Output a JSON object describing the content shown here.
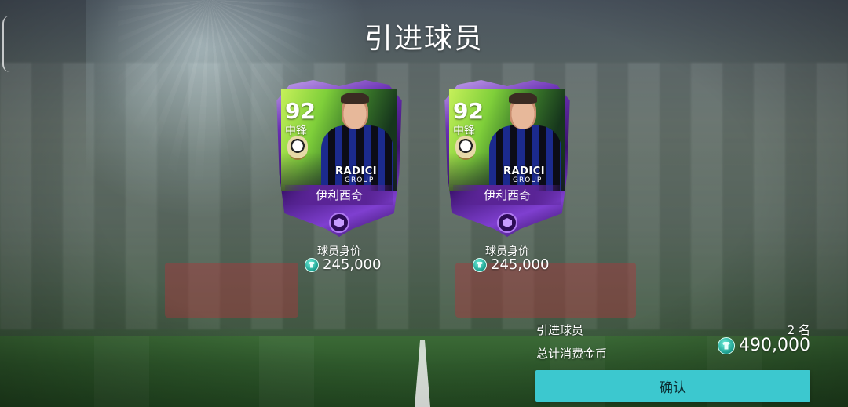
{
  "title": "引进球员",
  "players": [
    {
      "rating": "92",
      "position": "中锋",
      "name": "伊利西奇",
      "sponsor": "RADICI",
      "sponsor_sub": "GROUP",
      "value_label": "球员身价",
      "value": "245,000"
    },
    {
      "rating": "92",
      "position": "中锋",
      "name": "伊利西奇",
      "sponsor": "RADICI",
      "sponsor_sub": "GROUP",
      "value_label": "球员身价",
      "value": "245,000"
    }
  ],
  "summary": {
    "players_label": "引进球员",
    "players_count": "2 名",
    "total_label": "总计消费金币",
    "total_value": "490,000"
  },
  "confirm_label": "确认",
  "colors": {
    "accent": "#3cc8cf",
    "card_purple": "#5a2496"
  },
  "icons": {
    "coin": "shirt-coin-icon",
    "tier": "hexagon-gem-icon",
    "back": "back-bracket-icon"
  }
}
